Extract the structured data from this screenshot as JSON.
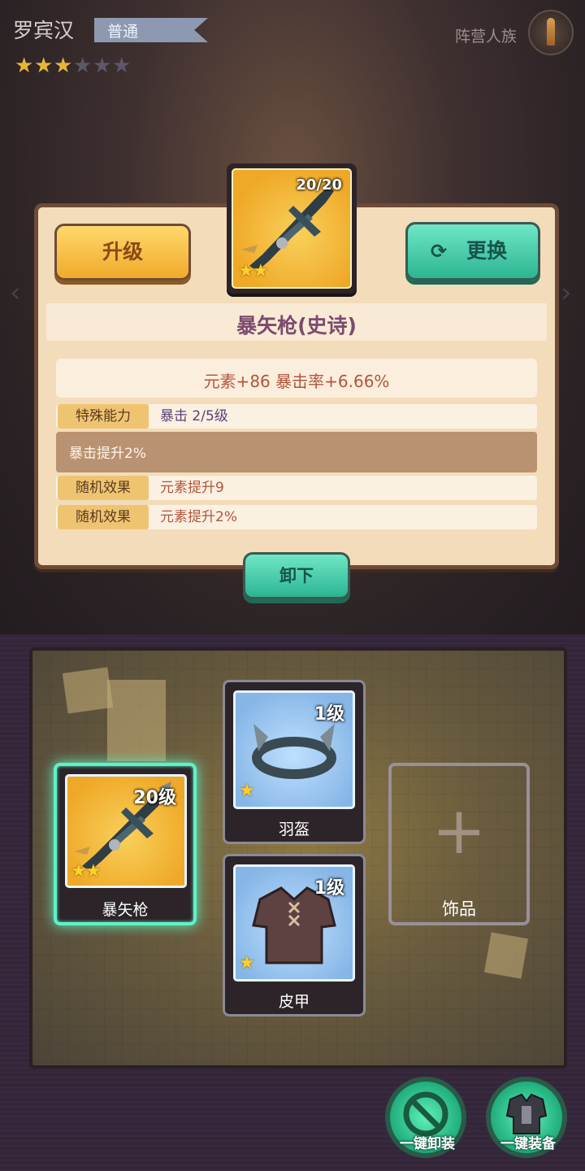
{
  "hero": {
    "name": "罗宾汉",
    "rarity": "普通",
    "faction": "阵营人族",
    "stars_filled": 3,
    "stars_total": 6
  },
  "detail": {
    "upgrade_label": "升级",
    "replace_label": "更换",
    "replace_icon": "refresh-icon",
    "item_count": "20/20",
    "item_stars": 2,
    "item_name": "暴矢枪(史诗)",
    "stats": "元素+86    暴击率+6.66%",
    "special": {
      "label": "特殊能力",
      "value": "暴击  2/5级"
    },
    "special_desc": "暴击提升2%",
    "random": [
      {
        "label": "随机效果",
        "value": "元素提升9"
      },
      {
        "label": "随机效果",
        "value": "元素提升2%"
      }
    ],
    "unequip_label": "卸下"
  },
  "equipment": {
    "weapon": {
      "level": "20级",
      "name": "暴矢枪",
      "stars": 2
    },
    "helmet": {
      "level": "1级",
      "name": "羽盔",
      "stars": 1
    },
    "armor": {
      "level": "1级",
      "name": "皮甲",
      "stars": 1
    },
    "accessory": {
      "name": "饰品"
    }
  },
  "actions": {
    "unequip_all": "一键卸装",
    "equip_all": "一键装备"
  },
  "colors": {
    "gold_button": "#f0aa2a",
    "teal_button": "#2cb591",
    "selected_glow": "#5ff2c6",
    "star_filled": "#e6b53a"
  }
}
